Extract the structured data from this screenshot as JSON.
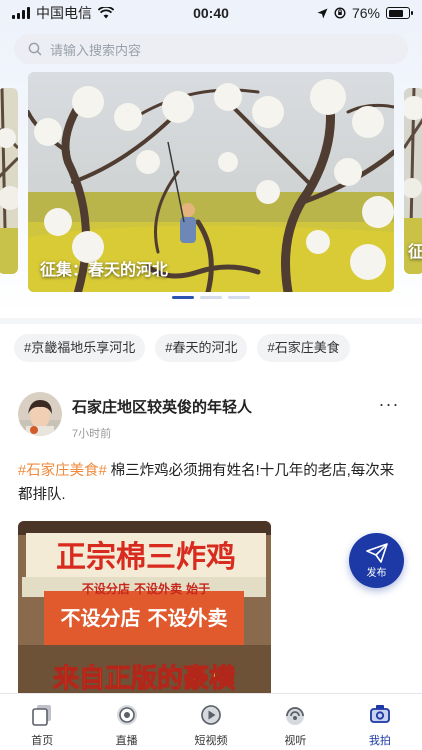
{
  "status_bar": {
    "carrier": "中国电信",
    "time": "00:40",
    "battery": "76%",
    "battery_level": 0.76
  },
  "search": {
    "placeholder": "请输入搜索内容"
  },
  "banner": {
    "caption": "征集：春天的河北",
    "side_caption": "征"
  },
  "tags": [
    "#京畿福地乐享河北",
    "#春天的河北",
    "#石家庄美食"
  ],
  "post": {
    "author": "石家庄地区较英俊的年轻人",
    "time": "7小时前",
    "more": "···",
    "hashtag": "#石家庄美食#",
    "text": " 棉三炸鸡必须拥有姓名!十几年的老店,每次来都排队.",
    "image_text": {
      "sign_top": "正宗棉三炸鸡",
      "sign_sub": "不设分店  不设外卖  始于",
      "sign_mid": "不设分店 不设外卖",
      "sign_bottom": "来自正版的豪横"
    }
  },
  "publish_label": "发布",
  "tabs": [
    {
      "label": "首页",
      "icon": "home-icon"
    },
    {
      "label": "直播",
      "icon": "live-icon"
    },
    {
      "label": "短视频",
      "icon": "short-video-icon"
    },
    {
      "label": "视听",
      "icon": "audio-visual-icon"
    },
    {
      "label": "我拍",
      "icon": "camera-icon"
    }
  ],
  "colors": {
    "accent": "#1c39a5",
    "hashtag": "#f08a3c"
  }
}
